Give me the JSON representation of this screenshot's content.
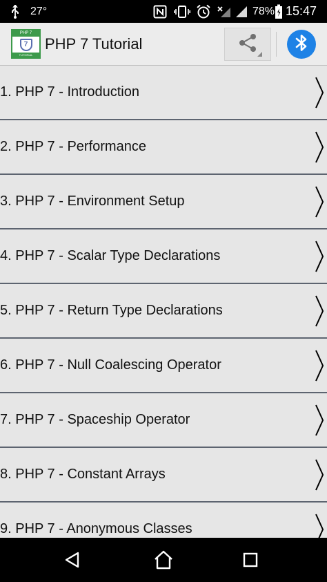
{
  "status_bar": {
    "usb_icon": "usb-icon",
    "temperature": "27°",
    "nfc_icon": "nfc-icon",
    "vibrate_icon": "vibrate-icon",
    "alarm_icon": "alarm-icon",
    "battery_percent": "78%",
    "time": "15:47"
  },
  "app_bar": {
    "title": "PHP 7 Tutorial",
    "logo_top": "PHP 7",
    "logo_mid": "7",
    "logo_bottom": "TUTORIAL",
    "share_icon": "share-icon",
    "bluetooth_icon": "bluetooth-icon"
  },
  "items": [
    {
      "label": "1. PHP 7 - Introduction"
    },
    {
      "label": "2. PHP 7 - Performance"
    },
    {
      "label": "3. PHP 7 - Environment Setup"
    },
    {
      "label": "4. PHP 7 - Scalar Type Declarations"
    },
    {
      "label": "5. PHP 7 - Return Type Declarations"
    },
    {
      "label": "6. PHP 7 - Null Coalescing Operator"
    },
    {
      "label": "7. PHP 7 - Spaceship Operator"
    },
    {
      "label": "8. PHP 7 - Constant Arrays"
    },
    {
      "label": "9. PHP 7 - Anonymous Classes"
    }
  ],
  "nav_bar": {
    "back_icon": "back-icon",
    "home_icon": "home-icon",
    "recents_icon": "recents-icon"
  },
  "colors": {
    "list_background": "#e6e6e6",
    "separator": "#5d6470",
    "bluetooth_accent": "#1e82e6",
    "logo_green": "#3d9a4b"
  }
}
